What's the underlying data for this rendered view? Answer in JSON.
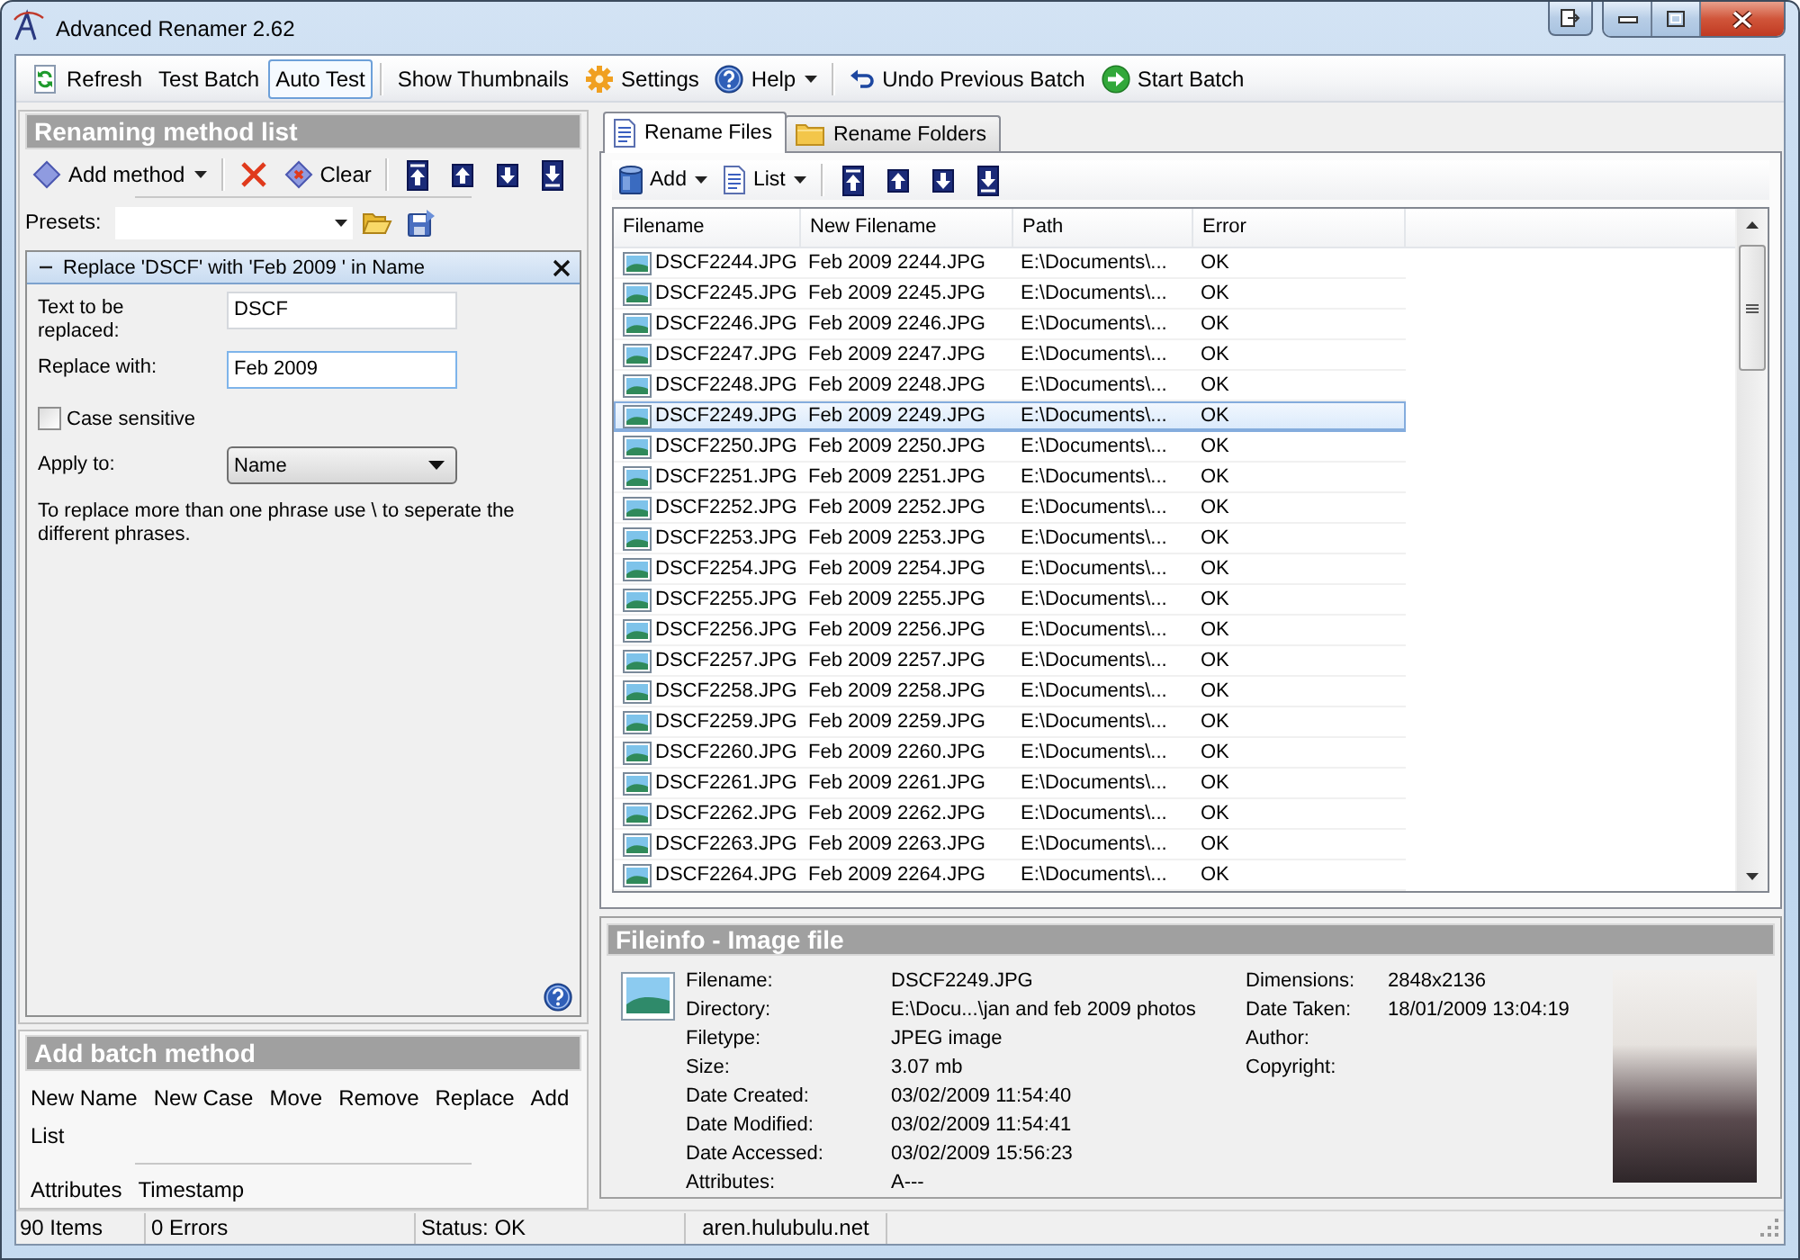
{
  "window": {
    "title": "Advanced Renamer 2.62"
  },
  "toolbar": {
    "groups": [
      [
        {
          "label": "Refresh",
          "on": false,
          "has_menu": false
        },
        {
          "label": "Test Batch",
          "on": false,
          "has_menu": false
        },
        {
          "label": "Auto Test",
          "on": true,
          "has_menu": false
        }
      ],
      [
        {
          "label": "Show Thumbnails",
          "on": false,
          "has_menu": false
        },
        {
          "label": "Settings",
          "on": false,
          "has_menu": false
        },
        {
          "label": "Help",
          "on": false,
          "has_menu": true
        }
      ],
      [
        {
          "label": "Undo Previous Batch",
          "on": false,
          "has_menu": false
        },
        {
          "label": "Start Batch",
          "on": false,
          "has_menu": false
        }
      ]
    ]
  },
  "method_list": {
    "title": "Renaming method list",
    "tools": [
      {
        "label": "Add method",
        "has_menu": true
      },
      {
        "label": "Clear",
        "has_menu": false
      }
    ],
    "presets": {
      "label": "Presets:"
    },
    "method": {
      "title": "Replace 'DSCF' with 'Feb 2009 ' in Name",
      "expanded": true,
      "fields": [
        {
          "label": "Text to be replaced:",
          "value": "DSCF",
          "focused": false
        },
        {
          "label": "Replace with:",
          "value": "Feb 2009",
          "focused": true
        }
      ],
      "case_sensitive": {
        "label": "Case sensitive",
        "checked": false
      },
      "apply_to": {
        "label": "Apply to:",
        "value": "Name"
      },
      "note": "To replace more than one phrase use \\ to seperate the different phrases."
    }
  },
  "batch_methods": {
    "title": "Add batch method",
    "groups": [
      {
        "rows": [
          [
            "New Name",
            "New Case",
            "Move",
            "Remove",
            "Replace",
            "Add"
          ],
          [
            "List"
          ]
        ]
      },
      {
        "rows": [
          [
            "Attributes",
            "Timestamp"
          ]
        ]
      }
    ]
  },
  "file_tabs": [
    {
      "label": "Rename Files",
      "selected": true
    },
    {
      "label": "Rename Folders",
      "selected": false
    }
  ],
  "file_tools": [
    {
      "label": "Add",
      "has_menu": true
    },
    {
      "label": "List",
      "has_menu": true
    }
  ],
  "table": {
    "columns": [
      "Filename",
      "New Filename",
      "Path",
      "Error"
    ],
    "rows": [
      {
        "cells": [
          "DSCF2244.JPG",
          "Feb 2009 2244.JPG",
          "E:\\Documents\\...",
          "OK"
        ],
        "selected": false
      },
      {
        "cells": [
          "DSCF2245.JPG",
          "Feb 2009 2245.JPG",
          "E:\\Documents\\...",
          "OK"
        ],
        "selected": false
      },
      {
        "cells": [
          "DSCF2246.JPG",
          "Feb 2009 2246.JPG",
          "E:\\Documents\\...",
          "OK"
        ],
        "selected": false
      },
      {
        "cells": [
          "DSCF2247.JPG",
          "Feb 2009 2247.JPG",
          "E:\\Documents\\...",
          "OK"
        ],
        "selected": false
      },
      {
        "cells": [
          "DSCF2248.JPG",
          "Feb 2009 2248.JPG",
          "E:\\Documents\\...",
          "OK"
        ],
        "selected": false
      },
      {
        "cells": [
          "DSCF2249.JPG",
          "Feb 2009 2249.JPG",
          "E:\\Documents\\...",
          "OK"
        ],
        "selected": true
      },
      {
        "cells": [
          "DSCF2250.JPG",
          "Feb 2009 2250.JPG",
          "E:\\Documents\\...",
          "OK"
        ],
        "selected": false
      },
      {
        "cells": [
          "DSCF2251.JPG",
          "Feb 2009 2251.JPG",
          "E:\\Documents\\...",
          "OK"
        ],
        "selected": false
      },
      {
        "cells": [
          "DSCF2252.JPG",
          "Feb 2009 2252.JPG",
          "E:\\Documents\\...",
          "OK"
        ],
        "selected": false
      },
      {
        "cells": [
          "DSCF2253.JPG",
          "Feb 2009 2253.JPG",
          "E:\\Documents\\...",
          "OK"
        ],
        "selected": false
      },
      {
        "cells": [
          "DSCF2254.JPG",
          "Feb 2009 2254.JPG",
          "E:\\Documents\\...",
          "OK"
        ],
        "selected": false
      },
      {
        "cells": [
          "DSCF2255.JPG",
          "Feb 2009 2255.JPG",
          "E:\\Documents\\...",
          "OK"
        ],
        "selected": false
      },
      {
        "cells": [
          "DSCF2256.JPG",
          "Feb 2009 2256.JPG",
          "E:\\Documents\\...",
          "OK"
        ],
        "selected": false
      },
      {
        "cells": [
          "DSCF2257.JPG",
          "Feb 2009 2257.JPG",
          "E:\\Documents\\...",
          "OK"
        ],
        "selected": false
      },
      {
        "cells": [
          "DSCF2258.JPG",
          "Feb 2009 2258.JPG",
          "E:\\Documents\\...",
          "OK"
        ],
        "selected": false
      },
      {
        "cells": [
          "DSCF2259.JPG",
          "Feb 2009 2259.JPG",
          "E:\\Documents\\...",
          "OK"
        ],
        "selected": false
      },
      {
        "cells": [
          "DSCF2260.JPG",
          "Feb 2009 2260.JPG",
          "E:\\Documents\\...",
          "OK"
        ],
        "selected": false
      },
      {
        "cells": [
          "DSCF2261.JPG",
          "Feb 2009 2261.JPG",
          "E:\\Documents\\...",
          "OK"
        ],
        "selected": false
      },
      {
        "cells": [
          "DSCF2262.JPG",
          "Feb 2009 2262.JPG",
          "E:\\Documents\\...",
          "OK"
        ],
        "selected": false
      },
      {
        "cells": [
          "DSCF2263.JPG",
          "Feb 2009 2263.JPG",
          "E:\\Documents\\...",
          "OK"
        ],
        "selected": false
      },
      {
        "cells": [
          "DSCF2264.JPG",
          "Feb 2009 2264.JPG",
          "E:\\Documents\\...",
          "OK"
        ],
        "selected": false
      }
    ]
  },
  "fileinfo": {
    "title": "Fileinfo - Image file",
    "details": [
      {
        "label": "Filename:",
        "value": "DSCF2249.JPG"
      },
      {
        "label": "Directory:",
        "value": "E:\\Docu...\\jan and feb 2009 photos"
      },
      {
        "label": "Filetype:",
        "value": "JPEG image"
      },
      {
        "label": "Size:",
        "value": "3.07 mb"
      },
      {
        "label": "Date Created:",
        "value": "03/02/2009 11:54:40"
      },
      {
        "label": "Date Modified:",
        "value": "03/02/2009 11:54:41"
      },
      {
        "label": "Date Accessed:",
        "value": "03/02/2009 15:56:23"
      },
      {
        "label": "Attributes:",
        "value": "A---"
      }
    ],
    "image_details": [
      {
        "label": "Dimensions:",
        "value": "2848x2136"
      },
      {
        "label": "Date Taken:",
        "value": "18/01/2009 13:04:19"
      },
      {
        "label": "Author:"
      },
      {
        "label": "Copyright:"
      }
    ]
  },
  "status_bar": [
    "90 Items",
    "0 Errors",
    "Status: OK",
    "aren.hulubulu.net"
  ]
}
